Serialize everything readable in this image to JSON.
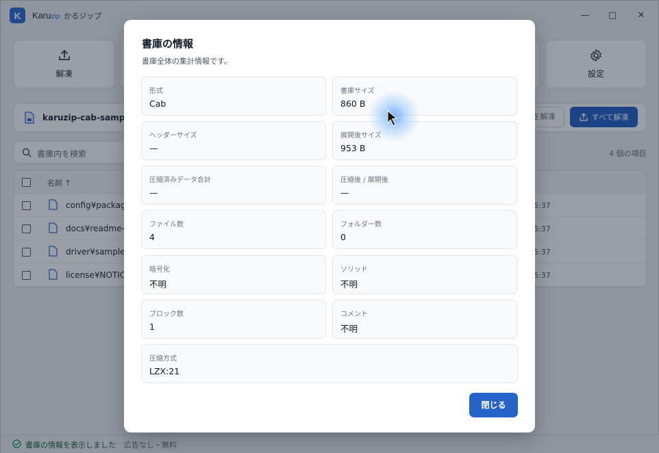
{
  "app": {
    "logo_letter": "K",
    "name_main": "Karu",
    "name_zip": "zip",
    "name_jp": "かるジップ",
    "minimize": "—",
    "maximize": "□",
    "close": "✕"
  },
  "toolbar": {
    "extract_label": "解凍",
    "settings_label": "設定"
  },
  "archive": {
    "file_name": "karuzip-cab-sample.cab",
    "extract_button": "を解凍",
    "extract_all_button": "すべて解凍"
  },
  "search": {
    "placeholder": "書庫内を検索",
    "item_count": "4 個の項目"
  },
  "table": {
    "col_name": "名前 ↑",
    "rows": [
      {
        "name": "config¥package",
        "time": "5:37"
      },
      {
        "name": "docs¥readme-j",
        "time": "5:37"
      },
      {
        "name": "driver¥sample-",
        "time": "5:37"
      },
      {
        "name": "license¥NOTICE",
        "time": "5:37"
      }
    ]
  },
  "status": {
    "message": "書庫の情報を表示しました",
    "separator": "·",
    "ad": "広告なし・無料"
  },
  "dialog": {
    "title": "書庫の情報",
    "subtitle": "書庫全体の集計情報です。",
    "fields": [
      {
        "label": "形式",
        "value": "Cab"
      },
      {
        "label": "書庫サイズ",
        "value": "860 B"
      },
      {
        "label": "ヘッダーサイズ",
        "value": "—"
      },
      {
        "label": "展開後サイズ",
        "value": "953 B"
      },
      {
        "label": "圧縮済みデータ合計",
        "value": "—"
      },
      {
        "label": "圧縮後 / 展開後",
        "value": "—"
      },
      {
        "label": "ファイル数",
        "value": "4"
      },
      {
        "label": "フォルダー数",
        "value": "0"
      },
      {
        "label": "暗号化",
        "value": "不明"
      },
      {
        "label": "ソリッド",
        "value": "不明"
      },
      {
        "label": "ブロック数",
        "value": "1"
      },
      {
        "label": "コメント",
        "value": "不明"
      },
      {
        "label": "圧縮方式",
        "value": "LZX:21"
      }
    ],
    "close_button": "閉じる"
  },
  "colors": {
    "accent": "#2563c9",
    "status_green": "#166534"
  }
}
